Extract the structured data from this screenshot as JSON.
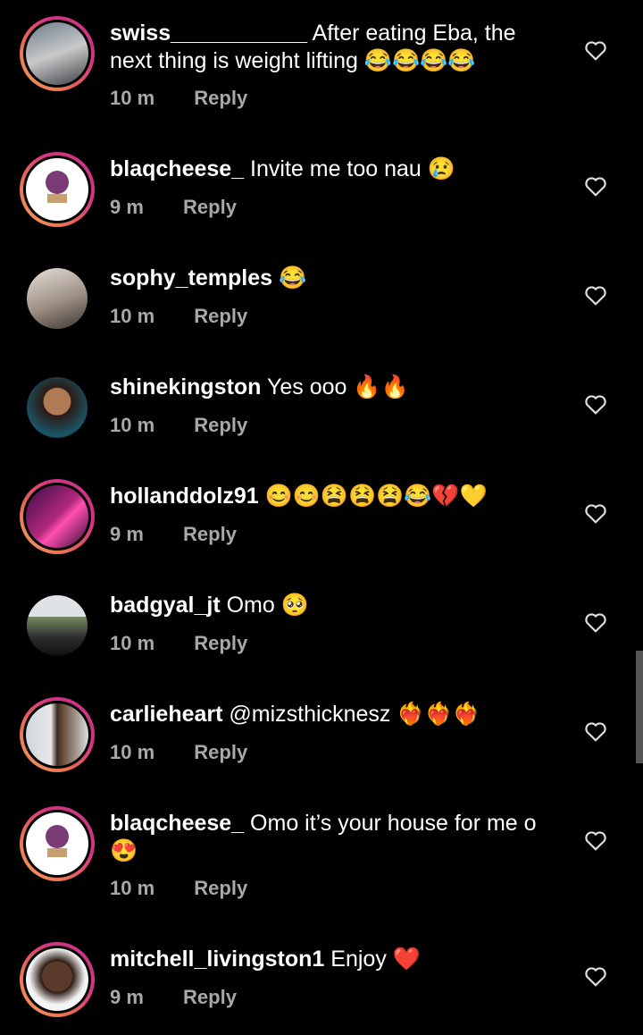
{
  "comments": [
    {
      "username": "swiss___________",
      "text": "After eating Eba, the next thing is weight lifting",
      "emoji": "😂😂😂😂",
      "time": "10 m",
      "reply": "Reply"
    },
    {
      "username": "blaqcheese_",
      "text": "Invite me too nau",
      "emoji": "😢",
      "time": "9 m",
      "reply": "Reply"
    },
    {
      "username": "sophy_temples",
      "text": "",
      "emoji": "😂",
      "time": "10 m",
      "reply": "Reply"
    },
    {
      "username": "shinekingston",
      "text": "Yes ooo",
      "emoji": "🔥🔥",
      "time": "10 m",
      "reply": "Reply"
    },
    {
      "username": "hollanddolz91",
      "text": "",
      "emoji": "😊😊😫😫😫😂💔💛",
      "time": "9 m",
      "reply": "Reply"
    },
    {
      "username": "badgyal_jt",
      "text": "Omo",
      "emoji": "🥺",
      "time": "10 m",
      "reply": "Reply"
    },
    {
      "username": "carlieheart",
      "text": "@mizsthicknesz",
      "emoji": "❤️‍🔥❤️‍🔥❤️‍🔥",
      "time": "10 m",
      "reply": "Reply"
    },
    {
      "username": "blaqcheese_",
      "text": "Omo it’s your house for me o",
      "emoji": "😍",
      "time": "10 m",
      "reply": "Reply"
    },
    {
      "username": "mitchell_livingston1",
      "text": "Enjoy",
      "emoji": "❤️",
      "time": "9 m",
      "reply": "Reply"
    }
  ],
  "colors": {
    "background": "#000000",
    "meta": "#a8a8a8",
    "story_ring": "#d63384"
  },
  "icons": {
    "like": "heart-outline-icon"
  }
}
